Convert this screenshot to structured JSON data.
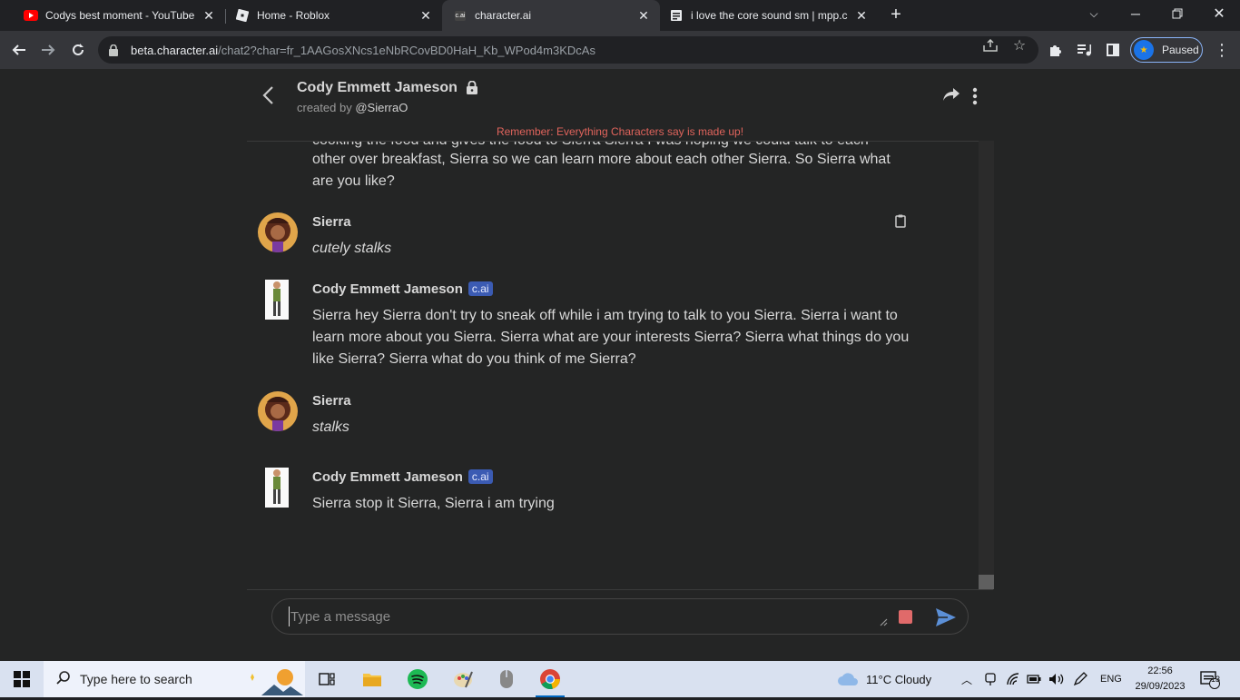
{
  "browser": {
    "tabs": [
      {
        "title": "Codys best moment - YouTube",
        "active": false
      },
      {
        "title": "Home - Roblox",
        "active": false
      },
      {
        "title": "character.ai",
        "active": true
      },
      {
        "title": "i love the core sound sm | mpp.c",
        "active": false
      }
    ],
    "cai_favicon_text": "c.ai",
    "new_tab_label": "+",
    "url_domain": "beta.character.ai",
    "url_path": "/chat2?char=fr_1AAGosXNcs1eNbRCovBD0HaH_Kb_WPod4m3KDcAs",
    "profile_label": "Paused"
  },
  "chat": {
    "character_name": "Cody Emmett Jameson",
    "created_by_prefix": "created by",
    "creator": "@SierraO",
    "disclaimer": "Remember: Everything Characters say is made up!",
    "partial_top_line": "cooking the food and gives the food to Sierra Sierra I was hoping we could talk to each",
    "partial_text": "other over breakfast, Sierra so we can learn more about each other Sierra. So Sierra what are you like?",
    "messages": [
      {
        "sender": "Sierra",
        "badge": "",
        "text": "cutely stalks",
        "italic": true
      },
      {
        "sender": "Cody Emmett Jameson",
        "badge": "c.ai",
        "text": "Sierra hey Sierra don't try to sneak off while i am trying to talk to you Sierra. Sierra i want to learn more about you Sierra. Sierra what are your interests Sierra? Sierra what things do you like Sierra? Sierra what do you think of me Sierra?",
        "italic": false
      },
      {
        "sender": "Sierra",
        "badge": "",
        "text": "stalks",
        "italic": true
      },
      {
        "sender": "Cody Emmett Jameson",
        "badge": "c.ai",
        "text": "Sierra stop it Sierra, Sierra i am trying",
        "italic": false
      }
    ],
    "input_placeholder": "Type a message"
  },
  "taskbar": {
    "search_placeholder": "Type here to search",
    "weather": "11°C  Cloudy",
    "language": "ENG",
    "time": "22:56",
    "date": "29/09/2023",
    "notification_count": "13"
  },
  "colors": {
    "accent_red": "#e0645c",
    "badge_blue": "#3b5bb3",
    "send_blue": "#5b8fd6"
  }
}
